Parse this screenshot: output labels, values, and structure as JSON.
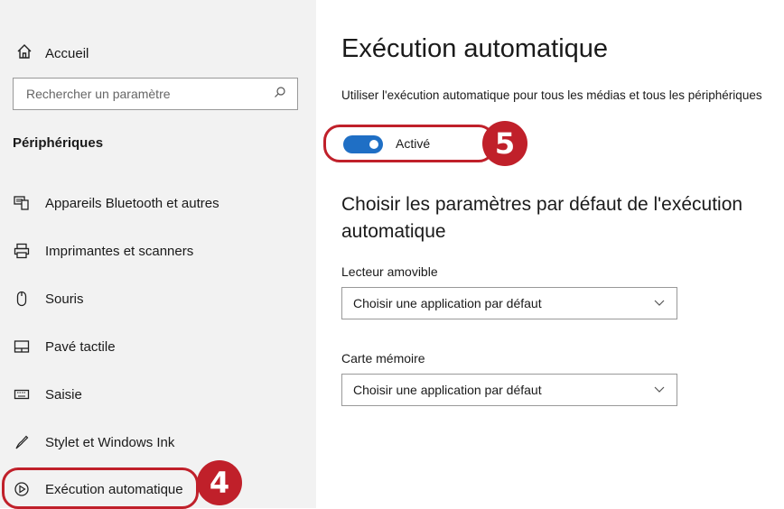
{
  "sidebar": {
    "home_label": "Accueil",
    "search_placeholder": "Rechercher un paramètre",
    "section_title": "Périphériques",
    "items": [
      {
        "label": "Appareils Bluetooth et autres",
        "icon": "bluetooth-devices-icon"
      },
      {
        "label": "Imprimantes et scanners",
        "icon": "printer-icon"
      },
      {
        "label": "Souris",
        "icon": "mouse-icon"
      },
      {
        "label": "Pavé tactile",
        "icon": "touchpad-icon"
      },
      {
        "label": "Saisie",
        "icon": "keyboard-icon"
      },
      {
        "label": "Stylet et Windows Ink",
        "icon": "pen-icon"
      },
      {
        "label": "Exécution automatique",
        "icon": "autoplay-icon"
      }
    ]
  },
  "main": {
    "title": "Exécution automatique",
    "description": "Utiliser l'exécution automatique pour tous les médias et tous les périphériques",
    "toggle": {
      "label": "Activé",
      "state": "on"
    },
    "subtitle": "Choisir les paramètres par défaut de l'exécution automatique",
    "fields": [
      {
        "label": "Lecteur amovible",
        "value": "Choisir une application par défaut"
      },
      {
        "label": "Carte mémoire",
        "value": "Choisir une application par défaut"
      }
    ]
  },
  "annotations": {
    "step4": "4",
    "step5": "5",
    "highlight_color": "#c0202a"
  },
  "colors": {
    "accent": "#1f6fc5",
    "sidebar_bg": "#f2f2f2"
  }
}
